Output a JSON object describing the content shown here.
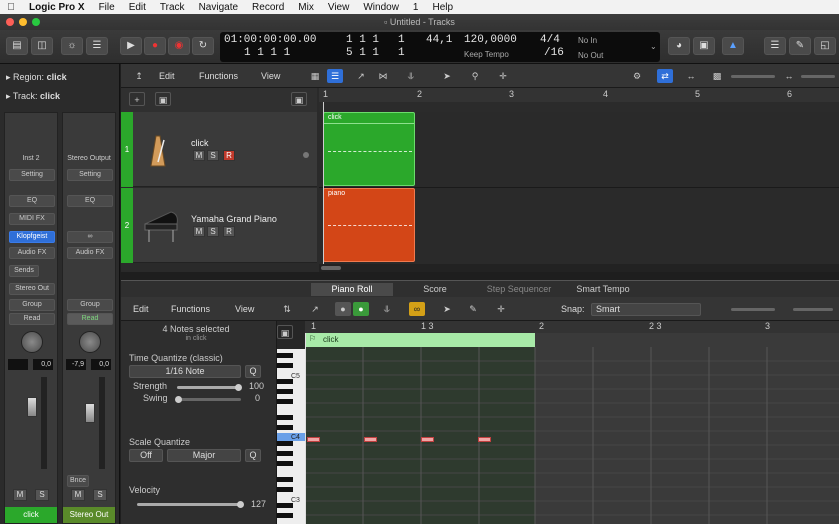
{
  "menubar": {
    "app": "Logic Pro X",
    "items": [
      "File",
      "Edit",
      "Track",
      "Navigate",
      "Record",
      "Mix",
      "View",
      "Window",
      "1",
      "Help"
    ]
  },
  "window": {
    "title": "Untitled - Tracks"
  },
  "lcd": {
    "smpte": "01:00:00:00.00",
    "smpte_sub": "1  1  1     1",
    "bars": "1 1 1",
    "bars_sub": "5 1 1",
    "bars_tail": "1",
    "bars_tail_sub": "1",
    "tempo_val": "44,1",
    "tempo": "120,0000",
    "tempo_mode": "Keep Tempo",
    "sig": "4/4",
    "sig_div": "/16",
    "midi_in": "No In",
    "midi_out": "No Out"
  },
  "inspector": {
    "region_label": "Region:",
    "region_name": "click",
    "track_label": "Track:",
    "track_name": "click",
    "strip1": {
      "input": "Inst 2",
      "setting": "Setting",
      "eq": "EQ",
      "midi_fx": "MIDI FX",
      "instrument": "Klopfgeist",
      "audio_fx": "Audio FX",
      "sends": "Sends",
      "output": "Stereo Out",
      "group": "Group",
      "read": "Read",
      "pan_val": "0,0",
      "vol_val": "",
      "m": "M",
      "s": "S",
      "name": "click"
    },
    "strip2": {
      "input": "Stereo Output",
      "setting": "Setting",
      "eq": "EQ",
      "audio_fx": "Audio FX",
      "group": "Group",
      "read": "Read",
      "pan_val": "0,0",
      "vol_val": "-7,9",
      "bnce": "Bnce",
      "m": "M",
      "s": "S",
      "name": "Stereo Out"
    }
  },
  "tracks_toolbar": {
    "edit": "Edit",
    "functions": "Functions",
    "view": "View"
  },
  "ruler": [
    "1",
    "2",
    "3",
    "4",
    "5",
    "6"
  ],
  "tracks": [
    {
      "num": "1",
      "name": "click",
      "m": "M",
      "s": "S",
      "r": "R",
      "region": "click",
      "region_color": "#2ba82b"
    },
    {
      "num": "2",
      "name": "Yamaha Grand Piano",
      "m": "M",
      "s": "S",
      "r": "R",
      "region": "piano",
      "region_color": "#d34617"
    }
  ],
  "pianoroll": {
    "tabs": [
      "Piano Roll",
      "Score",
      "Step Sequencer",
      "Smart Tempo"
    ],
    "edit": "Edit",
    "functions": "Functions",
    "view": "View",
    "snap_label": "Snap:",
    "snap_value": "Smart",
    "selection": "4 Notes selected",
    "selection_sub": "in click",
    "time_quantize_label": "Time Quantize (classic)",
    "time_quantize_value": "1/16 Note",
    "q": "Q",
    "strength_label": "Strength",
    "strength_value": "100",
    "swing_label": "Swing",
    "swing_value": "0",
    "scale_quantize_label": "Scale Quantize",
    "scale_off": "Off",
    "scale_mode": "Major",
    "velocity_label": "Velocity",
    "velocity_value": "127",
    "ruler": [
      "1",
      "1 3",
      "2",
      "2 3",
      "3"
    ],
    "region": "click",
    "keys": [
      "C5",
      "C4",
      "C3"
    ]
  }
}
